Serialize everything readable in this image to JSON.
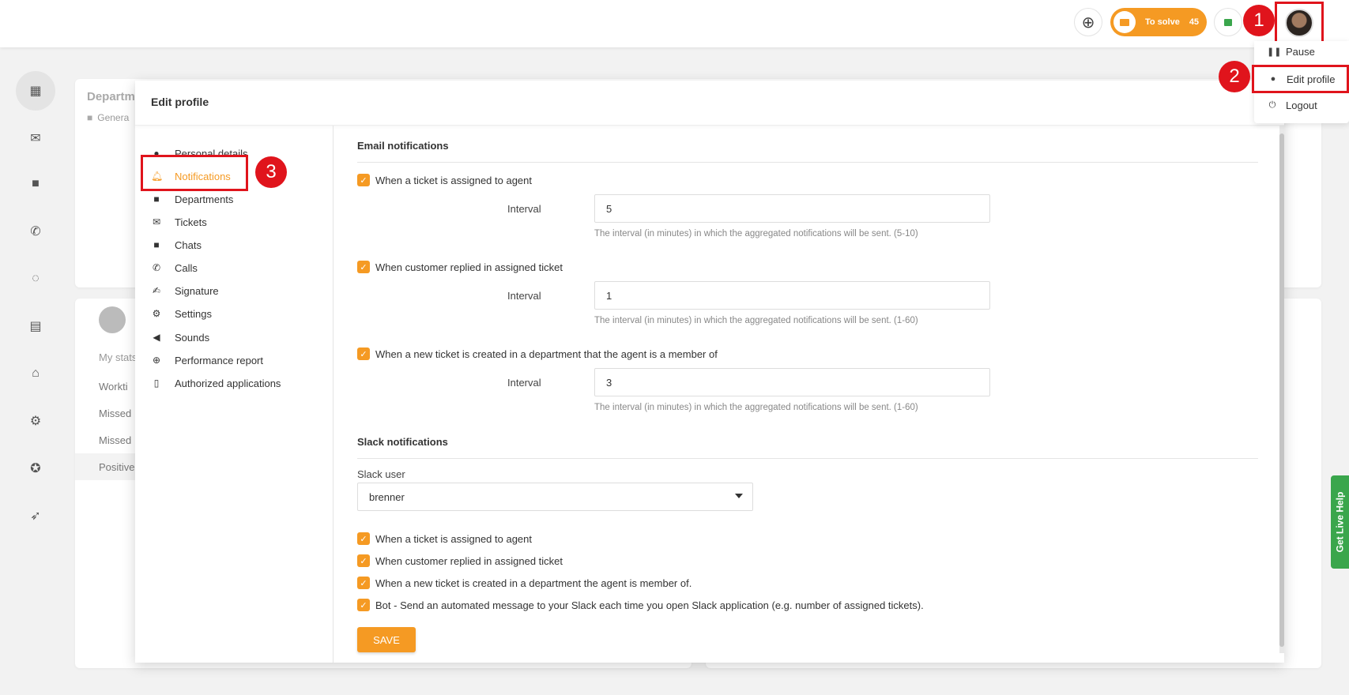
{
  "topbar": {
    "to_solve_label": "To solve",
    "to_solve_count": "45"
  },
  "annotations": [
    "1",
    "2",
    "3"
  ],
  "user_menu": {
    "items": [
      {
        "label": "Pause"
      },
      {
        "label": "Edit profile"
      },
      {
        "label": "Logout"
      }
    ]
  },
  "background": {
    "card1_title": "Departm",
    "card1_sub": "Genera",
    "stats_tab": "My stats",
    "rows": [
      "Workti",
      "Missed",
      "Missed",
      "Positive"
    ]
  },
  "modal": {
    "title": "Edit profile",
    "nav": [
      {
        "label": "Personal details",
        "icon": "person-icon"
      },
      {
        "label": "Notifications",
        "icon": "bell-icon"
      },
      {
        "label": "Departments",
        "icon": "folder-icon"
      },
      {
        "label": "Tickets",
        "icon": "envelope-icon"
      },
      {
        "label": "Chats",
        "icon": "chat-icon"
      },
      {
        "label": "Calls",
        "icon": "phone-icon"
      },
      {
        "label": "Signature",
        "icon": "signature-icon"
      },
      {
        "label": "Settings",
        "icon": "gear-icon"
      },
      {
        "label": "Sounds",
        "icon": "speaker-icon"
      },
      {
        "label": "Performance report",
        "icon": "globe-icon"
      },
      {
        "label": "Authorized applications",
        "icon": "mobile-icon"
      }
    ],
    "email_section": {
      "title": "Email notifications",
      "items": [
        {
          "label": "When a ticket is assigned to agent",
          "interval_label": "Interval",
          "interval": "5",
          "hint": "The interval (in minutes) in which the aggregated notifications will be sent. (5-10)"
        },
        {
          "label": "When customer replied in assigned ticket",
          "interval_label": "Interval",
          "interval": "1",
          "hint": "The interval (in minutes) in which the aggregated notifications will be sent. (1-60)"
        },
        {
          "label": "When a new ticket is created in a department that the agent is a member of",
          "interval_label": "Interval",
          "interval": "3",
          "hint": "The interval (in minutes) in which the aggregated notifications will be sent. (1-60)"
        }
      ]
    },
    "slack_section": {
      "title": "Slack notifications",
      "user_label": "Slack user",
      "user_value": "brenner",
      "items": [
        {
          "label": "When a ticket is assigned to agent"
        },
        {
          "label": "When customer replied in assigned ticket"
        },
        {
          "label": "When a new ticket is created in a department the agent is member of."
        },
        {
          "label": "Bot - Send an automated message to your Slack each time you open Slack application (e.g. number of assigned tickets)."
        }
      ]
    },
    "save_label": "SAVE"
  },
  "live_help": "Get Live Help",
  "colors": {
    "accent": "#f59a23",
    "annotation": "#e0141c",
    "live_help": "#3aa64c"
  }
}
